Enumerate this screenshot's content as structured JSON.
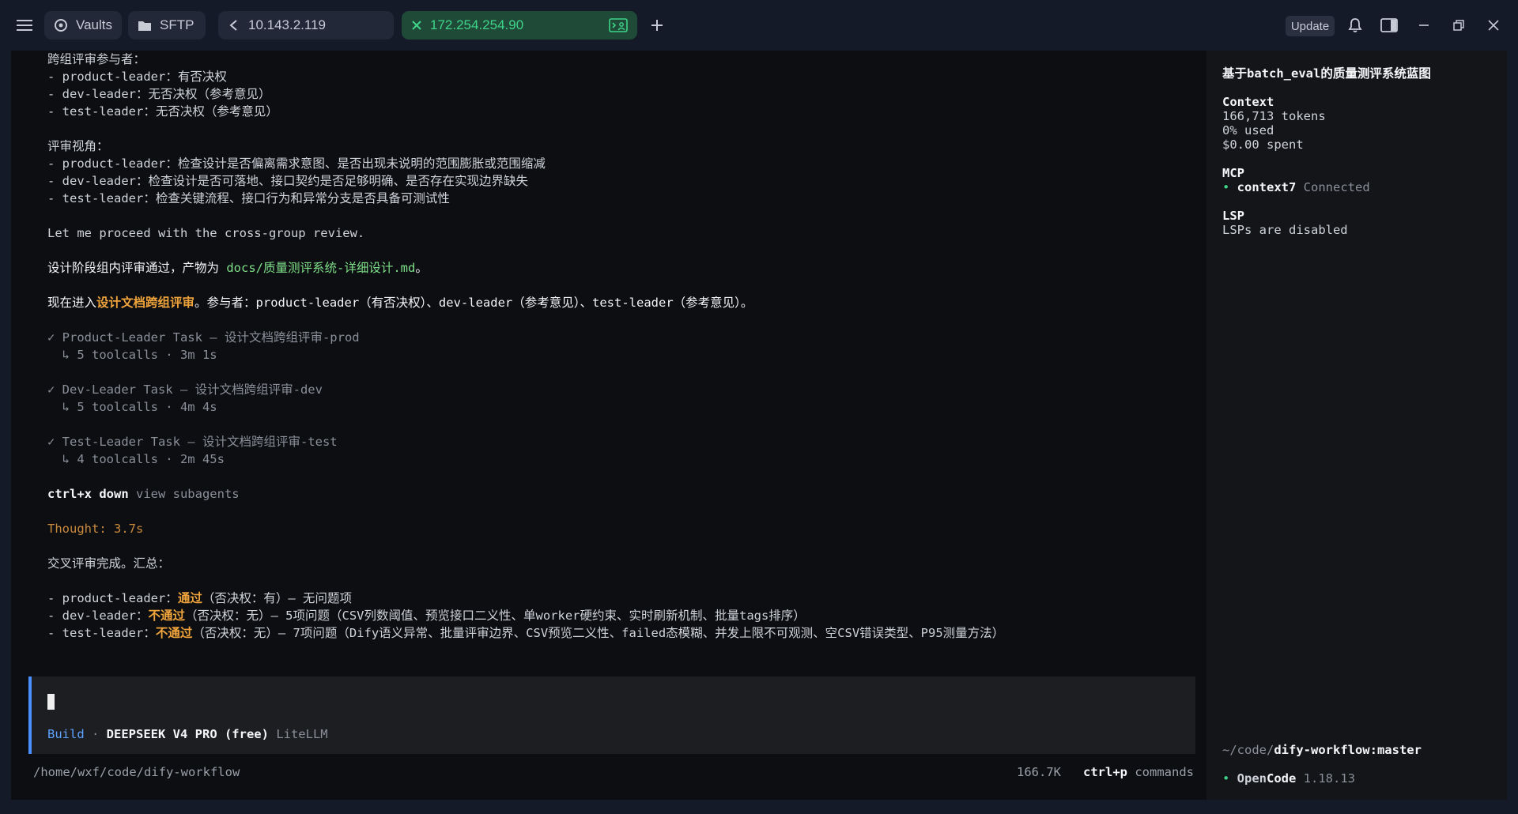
{
  "tabs": {
    "vaults": "Vaults",
    "sftp": "SFTP",
    "host1": "10.143.2.119",
    "host2": "172.254.254.90"
  },
  "toolbar": {
    "update": "Update"
  },
  "colors": {
    "accent_green": "#3fd489",
    "orange": "#f0a43c",
    "blue": "#5ea3ff",
    "link_green": "#7ee08a"
  },
  "main": {
    "reviewers_title": "跨组评审参与者：",
    "reviewers": [
      {
        "role": "- product-leader",
        "desc": "：有否决权"
      },
      {
        "role": "- dev-leader",
        "desc": "：无否决权（参考意见）"
      },
      {
        "role": "- test-leader",
        "desc": "：无否决权（参考意见）"
      }
    ],
    "perspective_title": "评审视角：",
    "perspectives": [
      {
        "role": "- product-leader",
        "desc": "：检查设计是否偏离需求意图、是否出现未说明的范围膨胀或范围缩减"
      },
      {
        "role": "- dev-leader",
        "desc": "：检查设计是否可落地、接口契约是否足够明确、是否存在实现边界缺失"
      },
      {
        "role": "- test-leader",
        "desc": "：检查关键流程、接口行为和异常分支是否具备可测试性"
      }
    ],
    "proceed": "Let me proceed with the cross-group review.",
    "passed_prefix": "设计阶段组内评审通过，产物为 ",
    "passed_file": "docs/质量测评系统-详细设计.md",
    "passed_suffix": "。",
    "enter_prefix": "现在进入",
    "enter_highlight": "设计文档跨组评审",
    "enter_suffix": "。参与者：product-leader（有否决权）、dev-leader（参考意见）、test-leader（参考意见）。",
    "tasks": [
      {
        "title": "✓ Product-Leader Task — 设计文档跨组评审-prod",
        "detail": "  ↳ 5 toolcalls · 3m 1s"
      },
      {
        "title": "✓ Dev-Leader Task — 设计文档跨组评审-dev",
        "detail": "  ↳ 5 toolcalls · 4m 4s"
      },
      {
        "title": "✓ Test-Leader Task — 设计文档跨组评审-test",
        "detail": "  ↳ 4 toolcalls · 2m 45s"
      }
    ],
    "shortcut_key": "ctrl+x down",
    "shortcut_desc": " view subagents",
    "thought": "Thought: 3.7s",
    "summary_title": "交叉评审完成。汇总：",
    "results": [
      {
        "role": "- product-leader：",
        "verdict": "通过",
        "detail": "（否决权：有）— 无问题项"
      },
      {
        "role": "- dev-leader：",
        "verdict": "不通过",
        "detail": "（否决权：无）— 5项问题（CSV列数阈值、预览接口二义性、单worker硬约束、实时刷新机制、批量tags排序）"
      },
      {
        "role": "- test-leader：",
        "verdict": "不通过",
        "detail": "（否决权：无）— 7项问题（Dify语义异常、批量评审边界、CSV预览二义性、failed态模糊、并发上限不可观测、空CSV错误类型、P95测量方法）"
      }
    ]
  },
  "input": {
    "mode": "Build",
    "sep": " · ",
    "model": "DEEPSEEK V4 PRO (free)",
    "provider": " LiteLLM"
  },
  "status": {
    "cwd": "/home/wxf/code/dify-workflow",
    "tokens": "166.7K",
    "cmd_key": "ctrl+p",
    "cmd_label": " commands"
  },
  "sidebar": {
    "title": "基于batch_eval的质量测评系统蓝图",
    "context_title": "Context",
    "context_tokens": "166,713 tokens",
    "context_used": "0% used",
    "context_spent": "$0.00 spent",
    "mcp_title": "MCP",
    "mcp_name": "context7",
    "mcp_status": " Connected",
    "lsp_title": "LSP",
    "lsp_status": "LSPs are disabled",
    "path_prefix": "~/code/",
    "path_repo": "dify-workflow:master",
    "app_open": "Open",
    "app_code": "Code",
    "app_version": " 1.18.13"
  }
}
